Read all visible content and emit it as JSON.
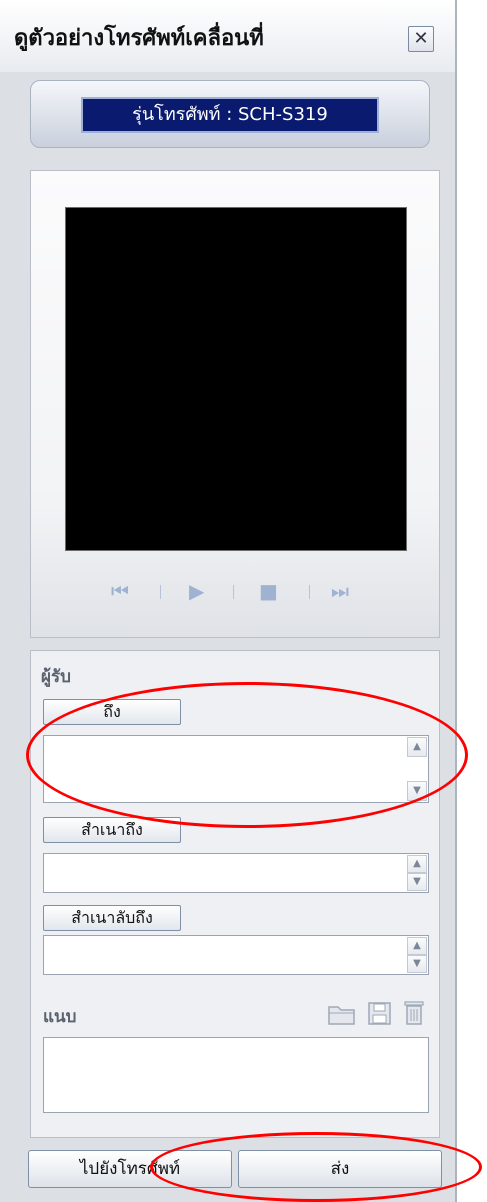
{
  "window": {
    "title": "ดูตัวอย่างโทรศัพท์เคลื่อนที่",
    "close_glyph": "✕"
  },
  "model": {
    "label": "รุ่นโทรศัพท์ : SCH-S319"
  },
  "player": {
    "controls": [
      {
        "name": "skip-back-icon",
        "glyph": "⏮"
      },
      {
        "name": "play-icon",
        "glyph": "▶"
      },
      {
        "name": "stop-icon",
        "glyph": "■"
      },
      {
        "name": "skip-forward-icon",
        "glyph": "⏭"
      }
    ]
  },
  "recipients": {
    "section_label": "ผู้รับ",
    "to_button": "ถึง",
    "cc_button": "สำเนาถึง",
    "bcc_button": "สำเนาลับถึง",
    "to_value": "",
    "cc_value": "",
    "bcc_value": ""
  },
  "attach": {
    "section_label": "แนบ",
    "icons": [
      "open-folder-icon",
      "save-icon",
      "delete-icon"
    ]
  },
  "footer": {
    "goto_phone_button": "ไปยังโทรศัพท์",
    "send_button": "ส่ง"
  },
  "colors": {
    "annotation": "#ff0000",
    "model_bg": "#0a1a6e"
  }
}
